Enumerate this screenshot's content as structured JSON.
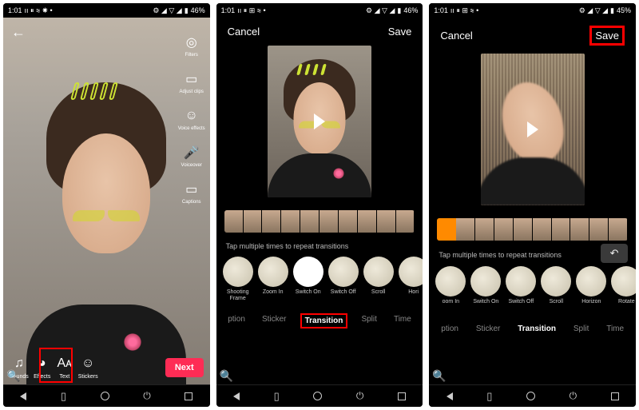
{
  "screens": [
    {
      "status": {
        "time": "1:01",
        "battery": "46%",
        "icons_left": "ıı ⏸ ≋ ☀ •",
        "icons_right": "⚙ ◢ ▽ ◢"
      },
      "side_tools": [
        {
          "name": "filters",
          "label": "Filters"
        },
        {
          "name": "adjust-clips",
          "label": "Adjust clips"
        },
        {
          "name": "voice-effects",
          "label": "Voice effects"
        },
        {
          "name": "voiceover",
          "label": "Voiceover"
        },
        {
          "name": "captions",
          "label": "Captions"
        }
      ],
      "bottom_tools": [
        {
          "name": "sounds",
          "label": "Sounds",
          "glyph": "♫"
        },
        {
          "name": "effects",
          "label": "Effects",
          "glyph": "◕"
        },
        {
          "name": "text",
          "label": "Text",
          "glyph": "Aᴀ"
        },
        {
          "name": "stickers",
          "label": "Stickers",
          "glyph": "☺"
        }
      ],
      "next": "Next"
    },
    {
      "status": {
        "time": "1:01",
        "battery": "46%",
        "icons_left": "ıı ⏸ ⊞ ≋ •",
        "icons_right": "⚙ ◢ ▽ ◢"
      },
      "cancel": "Cancel",
      "save": "Save",
      "tip": "Tap multiple times to repeat transitions",
      "timeline_progress": "2%",
      "thumbs": 10,
      "show_undo": false,
      "transitions": [
        {
          "label": "Shooting Frame",
          "circle": "plain"
        },
        {
          "label": "Zoom In",
          "circle": "plain"
        },
        {
          "label": "Switch On",
          "circle": "white"
        },
        {
          "label": "Switch Off",
          "circle": "plain"
        },
        {
          "label": "Scroll",
          "circle": "plain"
        },
        {
          "label": "Hori",
          "circle": "plain"
        }
      ],
      "tabs": [
        {
          "label": "ption",
          "active": false
        },
        {
          "label": "Sticker",
          "active": false
        },
        {
          "label": "Transition",
          "active": true,
          "highlight": true
        },
        {
          "label": "Split",
          "active": false
        },
        {
          "label": "Time",
          "active": false
        }
      ]
    },
    {
      "status": {
        "time": "1:01",
        "battery": "45%",
        "icons_left": "ıı ⏸ ⊞ ≋ •",
        "icons_right": "⚙ ◢ ▽ ◢"
      },
      "cancel": "Cancel",
      "save": "Save",
      "save_highlight": true,
      "tip": "Tap multiple times to repeat transitions",
      "timeline_progress": "10%",
      "thumbs": 10,
      "show_undo": true,
      "transitions": [
        {
          "label": "oom In",
          "circle": "plain"
        },
        {
          "label": "Switch On",
          "circle": "plain"
        },
        {
          "label": "Switch Off",
          "circle": "plain"
        },
        {
          "label": "Scroll",
          "circle": "plain"
        },
        {
          "label": "Horizon",
          "circle": "plain"
        },
        {
          "label": "Rotate",
          "circle": "plain"
        }
      ],
      "tabs": [
        {
          "label": "ption",
          "active": false
        },
        {
          "label": "Sticker",
          "active": false
        },
        {
          "label": "Transition",
          "active": true,
          "highlight": false
        },
        {
          "label": "Split",
          "active": false
        },
        {
          "label": "Time",
          "active": false
        }
      ]
    }
  ]
}
